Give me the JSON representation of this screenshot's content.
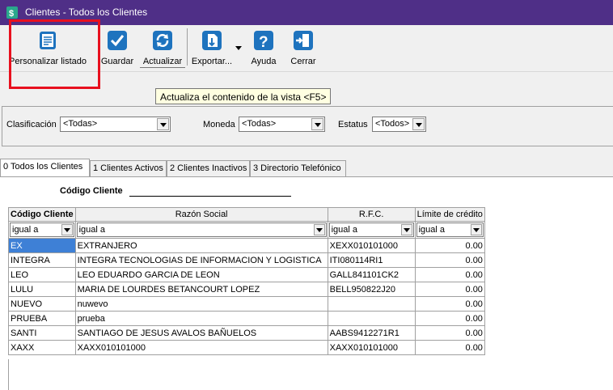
{
  "window": {
    "title": "Clientes - Todos los Clientes"
  },
  "toolbar": {
    "personalizar": "Personalizar listado",
    "guardar": "Guardar",
    "actualizar": "Actualizar",
    "exportar": "Exportar...",
    "ayuda": "Ayuda",
    "cerrar": "Cerrar"
  },
  "tooltip": "Actualiza el contenido de la vista <F5>",
  "filters": {
    "clasificacion": {
      "label": "Clasificación",
      "value": "<Todas>"
    },
    "moneda": {
      "label": "Moneda",
      "value": "<Todas>"
    },
    "estatus": {
      "label": "Estatus",
      "value": "<Todos>"
    }
  },
  "tabs": [
    "0 Todos los Clientes",
    "1 Clientes Activos",
    "2 Clientes Inactivos",
    "3 Directorio Telefónico"
  ],
  "codigo_cliente_label": "Código Cliente",
  "table": {
    "columns": [
      "Código Cliente",
      "Razón Social",
      "R.F.C.",
      "Límite de crédito"
    ],
    "filter_value": "igual a",
    "rows": [
      [
        "EX",
        "EXTRANJERO",
        "XEXX010101000",
        "0.00"
      ],
      [
        "INTEGRA",
        "INTEGRA TECNOLOGIAS DE INFORMACION Y LOGISTICA",
        "ITI080114RI1",
        "0.00"
      ],
      [
        "LEO",
        "LEO EDUARDO GARCIA DE LEON",
        "GALL841101CK2",
        "0.00"
      ],
      [
        "LULU",
        "MARIA DE LOURDES BETANCOURT LOPEZ",
        "BELL950822J20",
        "0.00"
      ],
      [
        "NUEVO",
        "nuwevo",
        "",
        "0.00"
      ],
      [
        "PRUEBA",
        "prueba",
        "",
        "0.00"
      ],
      [
        "SANTI",
        "SANTIAGO DE JESUS AVALOS BAÑUELOS",
        "AABS9412271R1",
        "0.00"
      ],
      [
        "XAXX",
        "XAXX010101000",
        "XAXX010101000",
        "0.00"
      ]
    ]
  },
  "colors": {
    "titlebar": "#4f2f87",
    "highlight": "#e8101e",
    "selected_cell": "#3e80d6",
    "icon_blue": "#1e73be"
  },
  "icons": {
    "app": "app-icon",
    "personalizar": "list-document-icon",
    "guardar": "checkmark-icon",
    "actualizar": "refresh-icon",
    "exportar": "export-icon",
    "ayuda": "help-icon",
    "cerrar": "exit-door-icon"
  }
}
